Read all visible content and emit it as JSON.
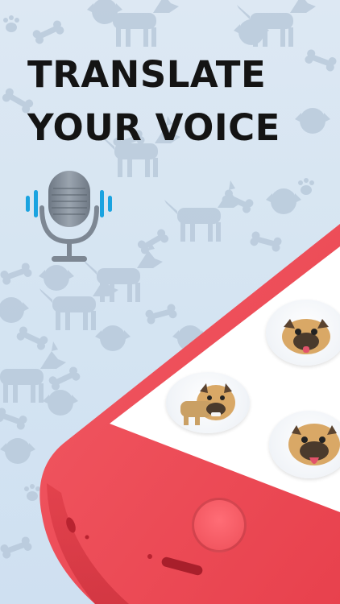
{
  "headline": {
    "line1": "TRANSLATE",
    "line2": "YOUR VOICE"
  },
  "icons": {
    "microphone": "microphone-icon",
    "sound_waves": "sound-wave-icon"
  },
  "colors": {
    "background": "#d6e4f2",
    "pattern": "#b7c8d9",
    "headline": "#141414",
    "mic_body": "#7d8793",
    "sound_wave": "#1aa3e0",
    "phone_frame": "#ef4e5a",
    "screen": "#ffffff"
  }
}
